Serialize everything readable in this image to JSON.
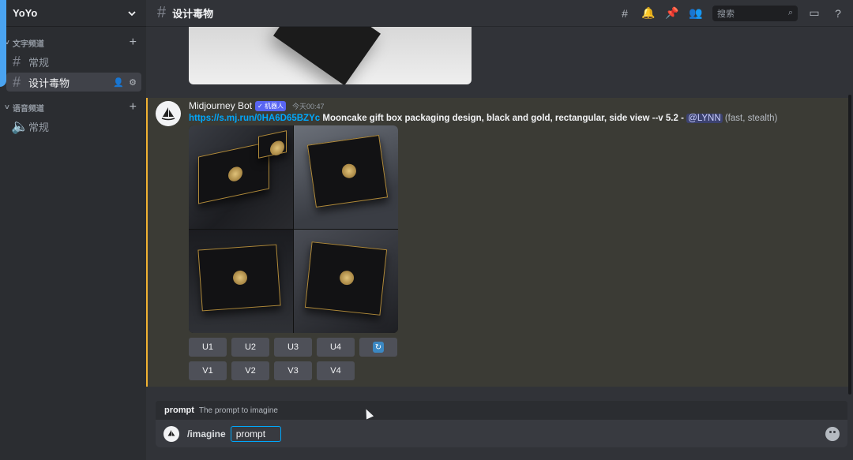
{
  "server": {
    "name": "YoYo"
  },
  "sidebar": {
    "categories": [
      {
        "label": "文字频道",
        "channels": [
          {
            "name": "常规"
          },
          {
            "name": "设计毒物",
            "active": true
          }
        ]
      },
      {
        "label": "语音频道",
        "channels": [
          {
            "name": "常规"
          }
        ]
      }
    ]
  },
  "topbar": {
    "channel": "设计毒物",
    "search_placeholder": "搜索"
  },
  "message": {
    "author": "Midjourney Bot",
    "badge": "✓ 机器人",
    "time": "今天00:47",
    "link": "https://s.mj.run/0HA6D65BZYc",
    "prompt": "Mooncake gift box packaging design, black and gold, rectangular, side view --v 5.2",
    "separator": "-",
    "mention": "@LYNN",
    "suffix": "(fast, stealth)",
    "buttons_row1": [
      "U1",
      "U2",
      "U3",
      "U4"
    ],
    "buttons_row2": [
      "V1",
      "V2",
      "V3",
      "V4"
    ]
  },
  "composer": {
    "option_name": "prompt",
    "option_desc": "The prompt to imagine",
    "command": "/imagine",
    "chip": "prompt"
  },
  "colors": {
    "accent": "#f0b232",
    "link": "#00a8fc",
    "badge": "#5865f2"
  }
}
